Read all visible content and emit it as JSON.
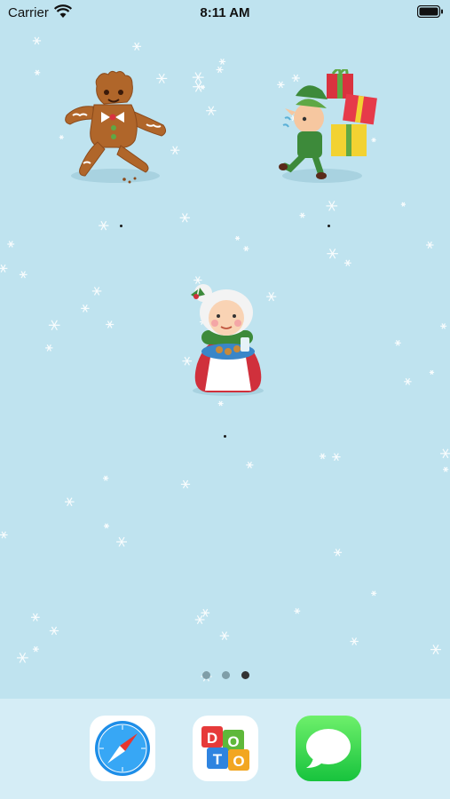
{
  "status_bar": {
    "carrier": "Carrier",
    "time": "8:11 AM"
  },
  "wallpaper": {
    "background_color": "#bfe3ef",
    "snowflake_color": "#ffffff"
  },
  "home_screen_icons": [
    {
      "name": "gingerbread-man-sticker",
      "label_visible": false
    },
    {
      "name": "elf-with-gifts-sticker",
      "label_visible": false
    },
    {
      "name": "mrs-claus-cookies-sticker",
      "label_visible": false
    }
  ],
  "page_indicator": {
    "pages": 3,
    "current_page": 3,
    "active_color": "#333333",
    "inactive_color": "#7f9ea8"
  },
  "dock": {
    "apps": [
      {
        "icon": "safari-compass-icon"
      },
      {
        "icon": "doto-app-icon",
        "letters": [
          "D",
          "O",
          "T",
          "O"
        ]
      },
      {
        "icon": "messages-bubble-icon"
      }
    ]
  }
}
